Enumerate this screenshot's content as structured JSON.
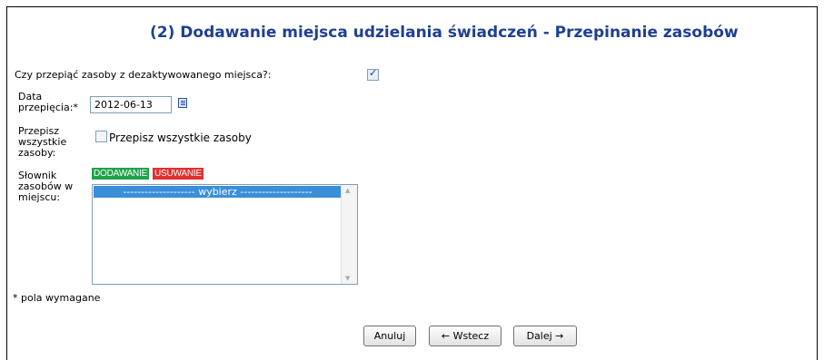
{
  "page": {
    "title": "(2) Dodawanie miejsca udzielania świadczeń - Przepinanie zasobów"
  },
  "form": {
    "question": "Czy przepiąć zasoby z dezaktywowanego miejsca?:",
    "question_checked": true,
    "date_label_line1": "Data",
    "date_label_line2": "przepięcia:*",
    "date_value": "2012-06-13",
    "rewrite_label_line1": "Przepisz",
    "rewrite_label_line2": "wszystkie",
    "rewrite_label_line3": "zasoby:",
    "rewrite_checkbox_label": "Przepisz wszystkie zasoby",
    "rewrite_checked": false,
    "dictionary_label_line1": "Słownik",
    "dictionary_label_line2": "zasobów w",
    "dictionary_label_line3": "miejscu:",
    "add_badge": "DODAWANIE",
    "remove_badge": "USUWANIE",
    "list_selected_option": "-------------------- wybierz --------------------",
    "required_note": "* pola wymagane"
  },
  "buttons": {
    "cancel": "Anuluj",
    "back": "← Wstecz",
    "next": "Dalej →"
  },
  "colors": {
    "title": "#1f3f92",
    "add_badge": "#1fa34a",
    "remove_badge": "#e03030",
    "selection": "#3b8ed8"
  }
}
